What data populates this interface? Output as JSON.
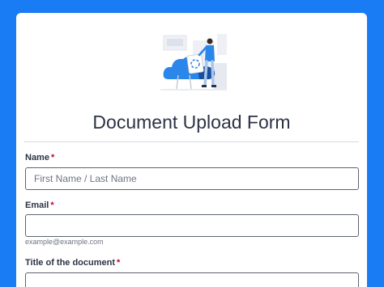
{
  "form": {
    "title": "Document Upload Form",
    "illustration_icon": "cloud-upload-illustration",
    "fields": [
      {
        "label": "Name",
        "required_mark": "*",
        "placeholder": "First Name / Last Name",
        "value": ""
      },
      {
        "label": "Email",
        "required_mark": "*",
        "placeholder": "",
        "value": "",
        "sublabel": "example@example.com"
      },
      {
        "label": "Title of the document",
        "required_mark": "*",
        "placeholder": "",
        "value": ""
      }
    ]
  },
  "colors": {
    "background": "#1a7cf5",
    "card": "#ffffff",
    "required": "#d0021b",
    "text": "#2c3345"
  }
}
